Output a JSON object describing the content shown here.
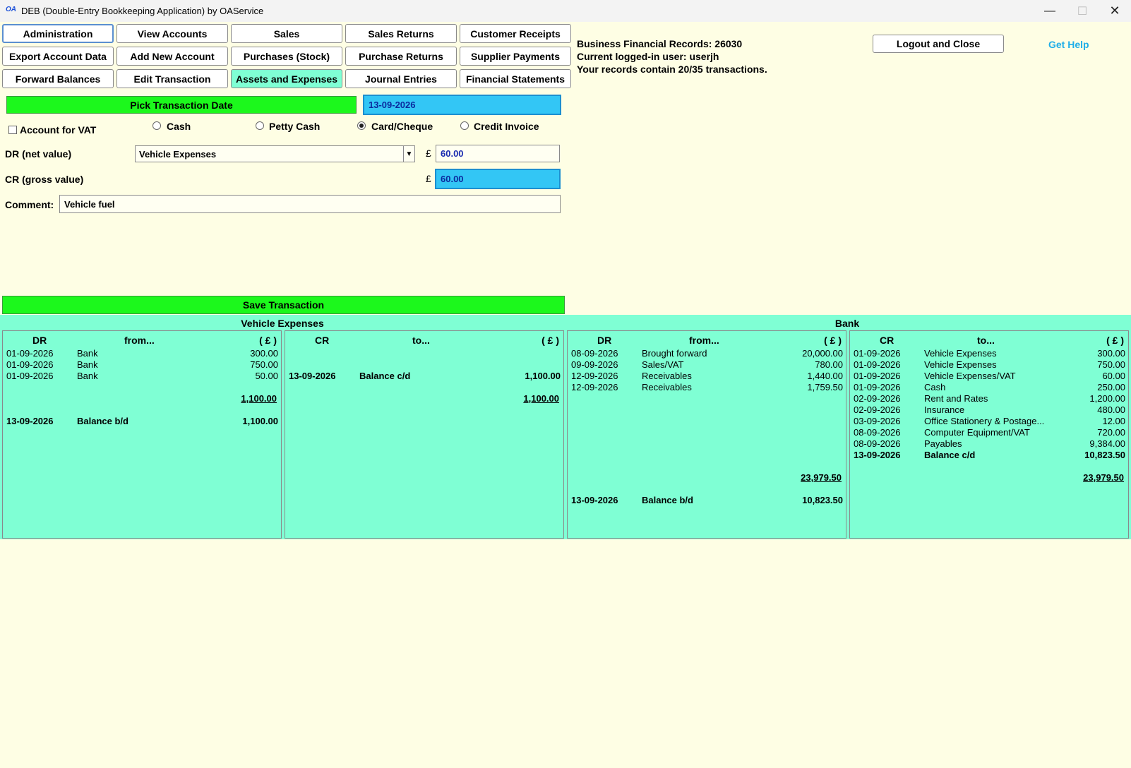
{
  "window": {
    "logo": "OA",
    "title": "DEB (Double-Entry Bookkeeping Application) by OAService"
  },
  "toolbar": {
    "row1": [
      "Administration",
      "View Accounts",
      "Sales",
      "Sales Returns",
      "Customer Receipts"
    ],
    "row2": [
      "Export Account Data",
      "Add New Account",
      "Purchases (Stock)",
      "Purchase Returns",
      "Supplier Payments"
    ],
    "row3": [
      "Forward Balances",
      "Edit Transaction",
      "Assets and Expenses",
      "Journal Entries",
      "Financial Statements"
    ]
  },
  "info": {
    "records": "Business Financial Records: 26030",
    "user": "Current logged-in user: userjh",
    "transactions": "Your records contain 20/35 transactions."
  },
  "header_actions": {
    "logout": "Logout and Close",
    "help": "Get Help"
  },
  "form": {
    "pick_date_label": "Pick Transaction Date",
    "date_value": "13-09-2026",
    "vat_label": "Account for VAT",
    "payment_options": [
      "Cash",
      "Petty Cash",
      "Card/Cheque",
      "Credit Invoice"
    ],
    "selected_payment": "Card/Cheque",
    "dr_label": "DR (net value)",
    "dr_account": "Vehicle Expenses",
    "currency": "£",
    "dr_value": "60.00",
    "cr_label": "CR (gross value)",
    "cr_value": "60.00",
    "comment_label": "Comment:",
    "comment_value": "Vehicle fuel",
    "save_label": "Save Transaction"
  },
  "ledgers": {
    "vehicle": {
      "title": "Vehicle Expenses",
      "dr": {
        "headers": [
          "DR",
          "from...",
          "( £ )"
        ],
        "rows": [
          {
            "date": "01-09-2026",
            "desc": "Bank",
            "amount": "300.00"
          },
          {
            "date": "01-09-2026",
            "desc": "Bank",
            "amount": "750.00"
          },
          {
            "date": "01-09-2026",
            "desc": "Bank",
            "amount": "50.00"
          }
        ],
        "total": "1,100.00",
        "balance": {
          "date": "13-09-2026",
          "desc": "Balance b/d",
          "amount": "1,100.00"
        }
      },
      "cr": {
        "headers": [
          "CR",
          "to...",
          "( £ )"
        ],
        "rows": [
          {
            "date": "13-09-2026",
            "desc": "Balance c/d",
            "amount": "1,100.00"
          }
        ],
        "total": "1,100.00"
      }
    },
    "bank": {
      "title": "Bank",
      "dr": {
        "headers": [
          "DR",
          "from...",
          "( £ )"
        ],
        "rows": [
          {
            "date": "08-09-2026",
            "desc": "Brought forward",
            "amount": "20,000.00"
          },
          {
            "date": "09-09-2026",
            "desc": "Sales/VAT",
            "amount": "780.00"
          },
          {
            "date": "12-09-2026",
            "desc": "Receivables",
            "amount": "1,440.00"
          },
          {
            "date": "12-09-2026",
            "desc": "Receivables",
            "amount": "1,759.50"
          }
        ],
        "total": "23,979.50",
        "balance": {
          "date": "13-09-2026",
          "desc": "Balance b/d",
          "amount": "10,823.50"
        }
      },
      "cr": {
        "headers": [
          "CR",
          "to...",
          "( £ )"
        ],
        "rows": [
          {
            "date": "01-09-2026",
            "desc": "Vehicle Expenses",
            "amount": "300.00"
          },
          {
            "date": "01-09-2026",
            "desc": "Vehicle Expenses",
            "amount": "750.00"
          },
          {
            "date": "01-09-2026",
            "desc": "Vehicle Expenses/VAT",
            "amount": "60.00"
          },
          {
            "date": "01-09-2026",
            "desc": "Cash",
            "amount": "250.00"
          },
          {
            "date": "02-09-2026",
            "desc": "Rent and Rates",
            "amount": "1,200.00"
          },
          {
            "date": "02-09-2026",
            "desc": "Insurance",
            "amount": "480.00"
          },
          {
            "date": "03-09-2026",
            "desc": "Office Stationery & Postage...",
            "amount": "12.00"
          },
          {
            "date": "08-09-2026",
            "desc": "Computer Equipment/VAT",
            "amount": "720.00"
          },
          {
            "date": "08-09-2026",
            "desc": "Payables",
            "amount": "9,384.00"
          },
          {
            "date": "13-09-2026",
            "desc": "Balance c/d",
            "amount": "10,823.50",
            "bold": true
          }
        ],
        "total": "23,979.50"
      }
    }
  }
}
